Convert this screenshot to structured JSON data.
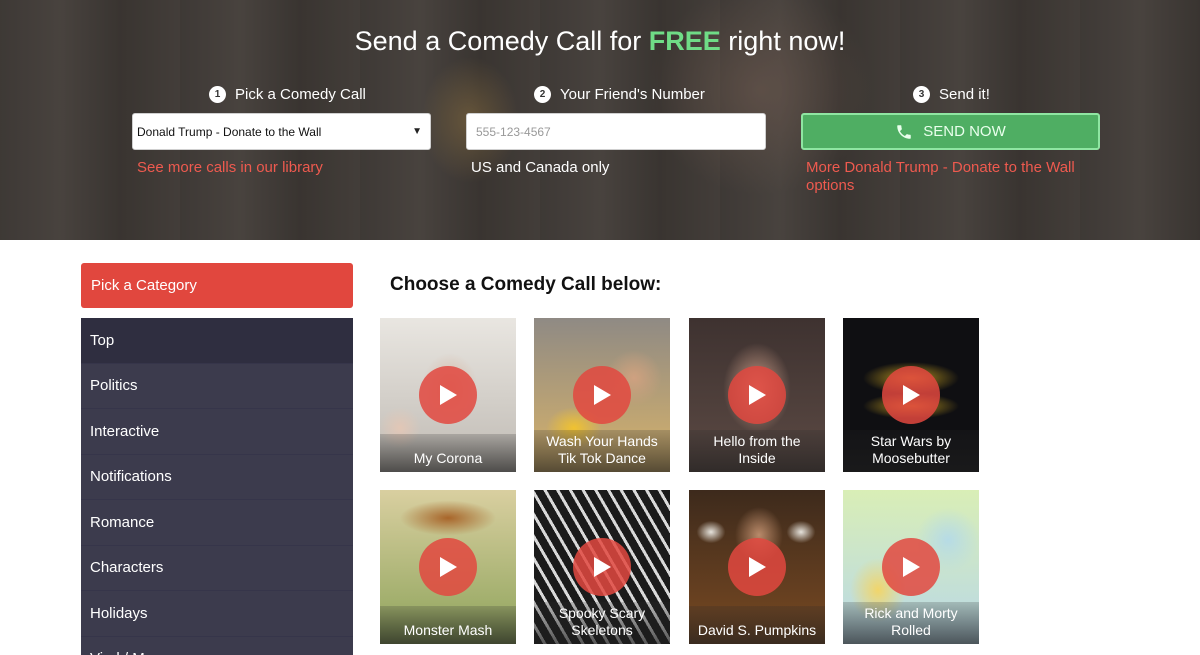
{
  "hero": {
    "title_prefix": "Send a Comedy Call for ",
    "title_free": "FREE",
    "title_suffix": " right now!",
    "steps": [
      {
        "num": "1",
        "label": "Pick a Comedy Call"
      },
      {
        "num": "2",
        "label": "Your Friend's Number"
      },
      {
        "num": "3",
        "label": "Send it!"
      }
    ],
    "selected_call": "Donald Trump - Donate to the Wall",
    "phone_placeholder": "555-123-4567",
    "send_label": "SEND NOW",
    "library_link": "See more calls in our library",
    "region_note": "US and Canada only",
    "more_options_link": "More Donald Trump - Donate to the Wall options"
  },
  "sidebar": {
    "header": "Pick a Category",
    "items": [
      "Top",
      "Politics",
      "Interactive",
      "Notifications",
      "Romance",
      "Characters",
      "Holidays",
      "Viral / M..."
    ]
  },
  "main": {
    "heading": "Choose a Comedy Call below:",
    "calls": [
      {
        "title": "My Corona"
      },
      {
        "title": "Wash Your Hands Tik Tok Dance"
      },
      {
        "title": "Hello from the Inside"
      },
      {
        "title": "Star Wars by Moosebutter"
      },
      {
        "title": "Monster Mash"
      },
      {
        "title": "Spooky Scary Skeletons"
      },
      {
        "title": "David S. Pumpkins"
      },
      {
        "title": "Rick and Morty Rolled"
      }
    ]
  },
  "colors": {
    "accent_red": "#e1473e",
    "send_green": "#4fae63",
    "free_green": "#6fdc86",
    "sidebar_bg": "#3c3b4d"
  }
}
